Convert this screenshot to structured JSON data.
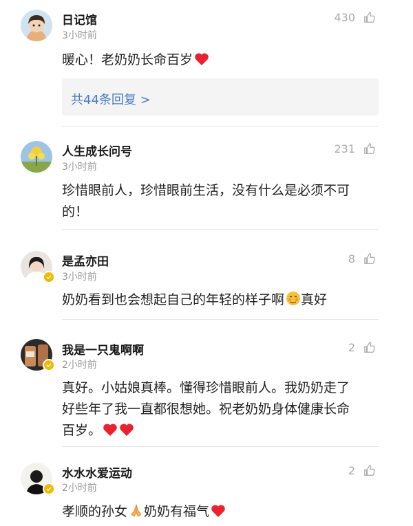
{
  "comments": [
    {
      "username": "日记馆",
      "time": "3小时前",
      "likes": "430",
      "text": "暖心！老奶奶长命百岁",
      "replies_label": "共44条回复 >"
    },
    {
      "username": "人生成长问号",
      "time": "3小时前",
      "likes": "231",
      "text_line1": "珍惜眼前人，珍惜眼前生活，没有什么是必须不可",
      "text_line2": "的！"
    },
    {
      "username": "是孟亦田",
      "time": "3小时前",
      "likes": "8",
      "text": "奶奶看到也会想起自己的年轻的样子啊",
      "text_after": "真好"
    },
    {
      "username": "我是一只鬼啊啊",
      "time": "2小时前",
      "likes": "2",
      "text_line1": "真好。小姑娘真棒。懂得珍惜眼前人。我奶奶走了",
      "text_line2": "好些年了我一直都很想她。祝老奶奶身体健康长命",
      "text_line3": "百岁。"
    },
    {
      "username": "水水水爱运动",
      "time": "2小时前",
      "likes": "2",
      "text": "孝顺的孙女",
      "text_after": "奶奶有福气"
    }
  ],
  "colors": {
    "link": "#4a7cc7",
    "heart": "#e8232f",
    "verified_badge": "#f5b800",
    "secondary_text": "#999999"
  },
  "icons": {
    "like": "thumbs-up-icon",
    "heart": "heart-emoji",
    "verified": "verified-badge-icon",
    "shy": "shy-face-emoji",
    "praying": "praying-hands-emoji"
  }
}
